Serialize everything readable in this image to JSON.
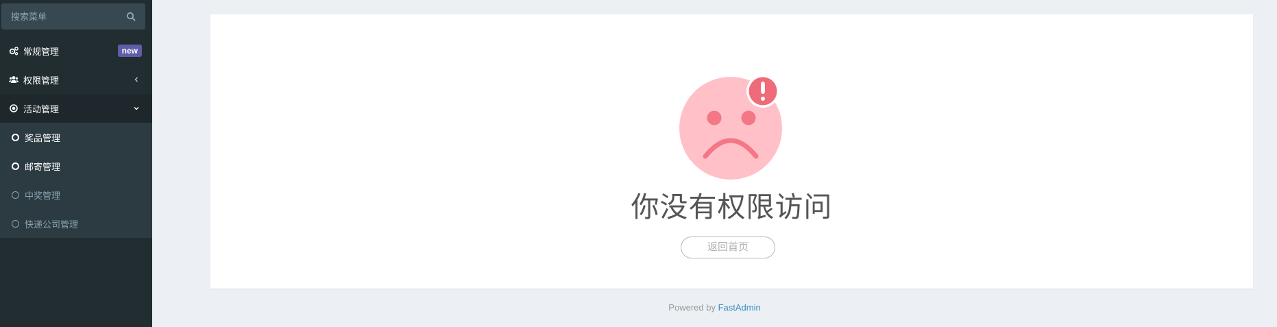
{
  "sidebar": {
    "search": {
      "placeholder": "搜索菜单"
    },
    "items": [
      {
        "label": "常规管理",
        "badge": "new",
        "icon": "cogs-icon"
      },
      {
        "label": "权限管理",
        "icon": "users-icon",
        "chevron": "chevron-left-icon"
      },
      {
        "label": "活动管理",
        "icon": "dot-circle-icon",
        "chevron": "chevron-down-icon"
      }
    ],
    "submenu": [
      {
        "label": "奖品管理",
        "state": "active"
      },
      {
        "label": "邮寄管理",
        "state": "active"
      },
      {
        "label": "中奖管理",
        "state": "inactive"
      },
      {
        "label": "快递公司管理",
        "state": "inactive"
      }
    ]
  },
  "main": {
    "message": "你没有权限访问",
    "home_button": "返回首页"
  },
  "footer": {
    "prefix": "Powered by ",
    "link": "FastAdmin"
  },
  "colors": {
    "sidebar_bg": "#222d32",
    "sidebar_active_bg": "#1e282c",
    "submenu_bg": "#2c3b41",
    "badge_bg": "#605ca8",
    "page_bg": "#ecf0f5",
    "face": "#ffc1c7",
    "face_features": "#f47785",
    "alert": "#f06b79",
    "link": "#3c8dbc"
  }
}
